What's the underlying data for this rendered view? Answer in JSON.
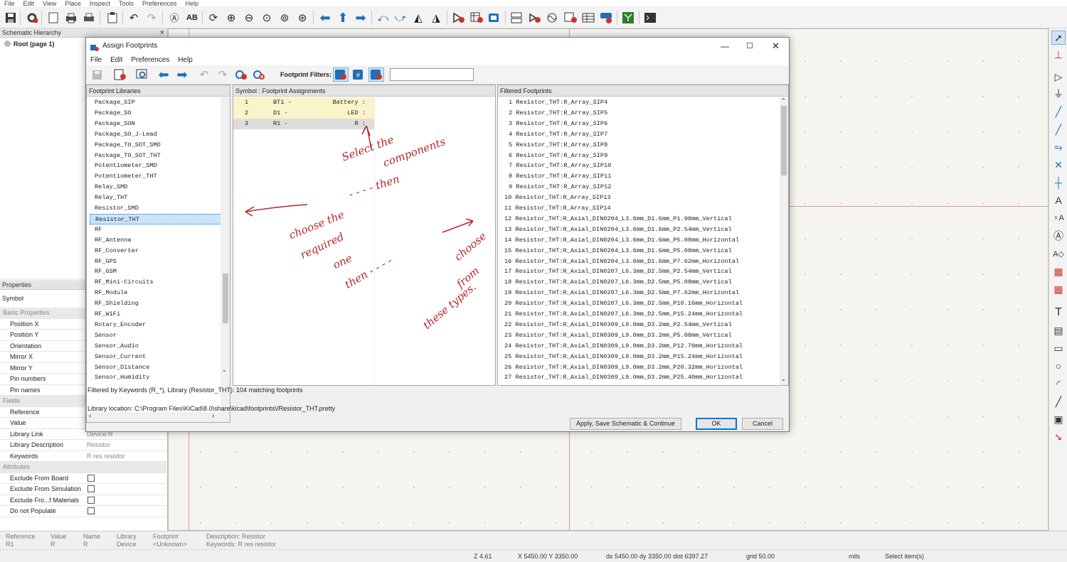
{
  "menubar": [
    "File",
    "Edit",
    "View",
    "Place",
    "Inspect",
    "Tools",
    "Preferences",
    "Help"
  ],
  "hierarchy": {
    "title": "Schematic Hierarchy",
    "close": "×",
    "root": "Root (page 1)"
  },
  "properties": {
    "title": "Properties",
    "symbol": "Symbol",
    "sections": {
      "basic": "Basic Properties",
      "fields": "Fields",
      "attributes": "Attributes"
    },
    "basic_rows": [
      {
        "label": "Position X",
        "value": ""
      },
      {
        "label": "Position Y",
        "value": ""
      },
      {
        "label": "Orientation",
        "value": ""
      },
      {
        "label": "Mirror X",
        "value": ""
      },
      {
        "label": "Mirror Y",
        "value": ""
      },
      {
        "label": "Pin numbers",
        "value": ""
      },
      {
        "label": "Pin names",
        "value": ""
      }
    ],
    "field_rows": [
      {
        "label": "Reference",
        "value": ""
      },
      {
        "label": "Value",
        "value": ""
      },
      {
        "label": "Library Link",
        "value": "Device:R"
      },
      {
        "label": "Library Description",
        "value": "Resistor"
      },
      {
        "label": "Keywords",
        "value": "R res resistor"
      }
    ],
    "attribute_rows": [
      {
        "label": "Exclude From Board",
        "checked": false
      },
      {
        "label": "Exclude From Simulation",
        "checked": false
      },
      {
        "label": "Exclude Fro...f Materials",
        "checked": false
      },
      {
        "label": "Do not Populate",
        "checked": false
      }
    ]
  },
  "bottom_info": {
    "reference": {
      "label": "Reference",
      "value": "R1"
    },
    "value": {
      "label": "Value",
      "value": "R"
    },
    "name": {
      "label": "Name",
      "value": "R"
    },
    "library": {
      "label": "Library",
      "value": "Device"
    },
    "footprint": {
      "label": "Footprint",
      "value": "<Unknown>"
    },
    "description": "Description: Resistor",
    "keywords": "Keywords: R res resistor"
  },
  "status": {
    "zoom": "Z 4.61",
    "xy": "X 5450.00  Y 3350.00",
    "dxdy": "dx 5450.00  dy 3350.00  dist 6397.27",
    "grid": "grid 50.00",
    "units": "mils",
    "mode": "Select item(s)"
  },
  "dialog": {
    "title": "Assign Footprints",
    "menu": [
      "File",
      "Edit",
      "Preferences",
      "Help"
    ],
    "filters_label": "Footprint Filters:",
    "filter_input": "",
    "libraries_header": "Footprint Libraries",
    "assignments_header": "Symbol : Footprint Assignments",
    "filtered_header": "Filtered Footprints",
    "libraries": [
      "Package_SIP",
      "Package_SO",
      "Package_SON",
      "Package_SO_J-Lead",
      "Package_TO_SOT_SMD",
      "Package_TO_SOT_THT",
      "Potentiometer_SMD",
      "Potentiometer_THT",
      "Relay_SMD",
      "Relay_THT",
      "Resistor_SMD",
      "Resistor_THT",
      "RF",
      "RF_Antenna",
      "RF_Converter",
      "RF_GPS",
      "RF_GSM",
      "RF_Mini-Circuits",
      "RF_Module",
      "RF_Shielding",
      "RF_WiFi",
      "Rotary_Encoder",
      "Sensor",
      "Sensor_Audio",
      "Sensor_Current",
      "Sensor_Distance",
      "Sensor_Humidity"
    ],
    "selected_library": "Resistor_THT",
    "assignments": [
      {
        "num": "1",
        "ref": "BT1 -",
        "value": "Battery :",
        "footprint": ""
      },
      {
        "num": "2",
        "ref": "D1 -",
        "value": "LED :",
        "footprint": ""
      },
      {
        "num": "3",
        "ref": "R1 -",
        "value": "R :",
        "footprint": ""
      }
    ],
    "footprints": [
      "1 Resistor_THT:R_Array_SIP4",
      "2 Resistor_THT:R_Array_SIP5",
      "3 Resistor_THT:R_Array_SIP6",
      "4 Resistor_THT:R_Array_SIP7",
      "5 Resistor_THT:R_Array_SIP8",
      "6 Resistor_THT:R_Array_SIP9",
      "7 Resistor_THT:R_Array_SIP10",
      "8 Resistor_THT:R_Array_SIP11",
      "9 Resistor_THT:R_Array_SIP12",
      "10 Resistor_THT:R_Array_SIP13",
      "11 Resistor_THT:R_Array_SIP14",
      "12 Resistor_THT:R_Axial_DIN0204_L3.6mm_D1.6mm_P1.90mm_Vertical",
      "13 Resistor_THT:R_Axial_DIN0204_L3.6mm_D1.6mm_P2.54mm_Vertical",
      "14 Resistor_THT:R_Axial_DIN0204_L3.6mm_D1.6mm_P5.08mm_Horizontal",
      "15 Resistor_THT:R_Axial_DIN0204_L3.6mm_D1.6mm_P5.08mm_Vertical",
      "16 Resistor_THT:R_Axial_DIN0204_L3.6mm_D1.6mm_P7.62mm_Horizontal",
      "17 Resistor_THT:R_Axial_DIN0207_L6.3mm_D2.5mm_P2.54mm_Vertical",
      "18 Resistor_THT:R_Axial_DIN0207_L6.3mm_D2.5mm_P5.08mm_Vertical",
      "19 Resistor_THT:R_Axial_DIN0207_L6.3mm_D2.5mm_P7.62mm_Horizontal",
      "20 Resistor_THT:R_Axial_DIN0207_L6.3mm_D2.5mm_P10.16mm_Horizontal",
      "21 Resistor_THT:R_Axial_DIN0207_L6.3mm_D2.5mm_P15.24mm_Horizontal",
      "22 Resistor_THT:R_Axial_DIN0309_L9.0mm_D3.2mm_P2.54mm_Vertical",
      "23 Resistor_THT:R_Axial_DIN0309_L9.0mm_D3.2mm_P5.08mm_Vertical",
      "24 Resistor_THT:R_Axial_DIN0309_L9.0mm_D3.2mm_P12.70mm_Horizontal",
      "25 Resistor_THT:R_Axial_DIN0309_L9.0mm_D3.2mm_P15.24mm_Horizontal",
      "26 Resistor_THT:R_Axial_DIN0309_L9.0mm_D3.2mm_P20.32mm_Horizontal",
      "27 Resistor_THT:R_Axial_DIN0309_L9.0mm_D3.2mm_P25.40mm_Horizontal"
    ],
    "filter_status": "Filtered by Keywords (R_*), Library (Resistor_THT): 104 matching footprints",
    "library_location": "Library location: C:\\Program Files\\KiCad\\8.0\\share\\kicad\\footprints\\/Resistor_THT.pretty",
    "buttons": {
      "apply": "Apply, Save Schematic & Continue",
      "ok": "OK",
      "cancel": "Cancel"
    },
    "annotations": {
      "select": "Select the",
      "components": "components",
      "then1": "- - - - then",
      "choose": "choose the",
      "required": "required",
      "one": "one",
      "then2": "then - - - -",
      "choose2": "choose",
      "from": "from",
      "these": "these types."
    }
  },
  "accent_color": "#0078d7",
  "annotation_color": "#b8262a"
}
